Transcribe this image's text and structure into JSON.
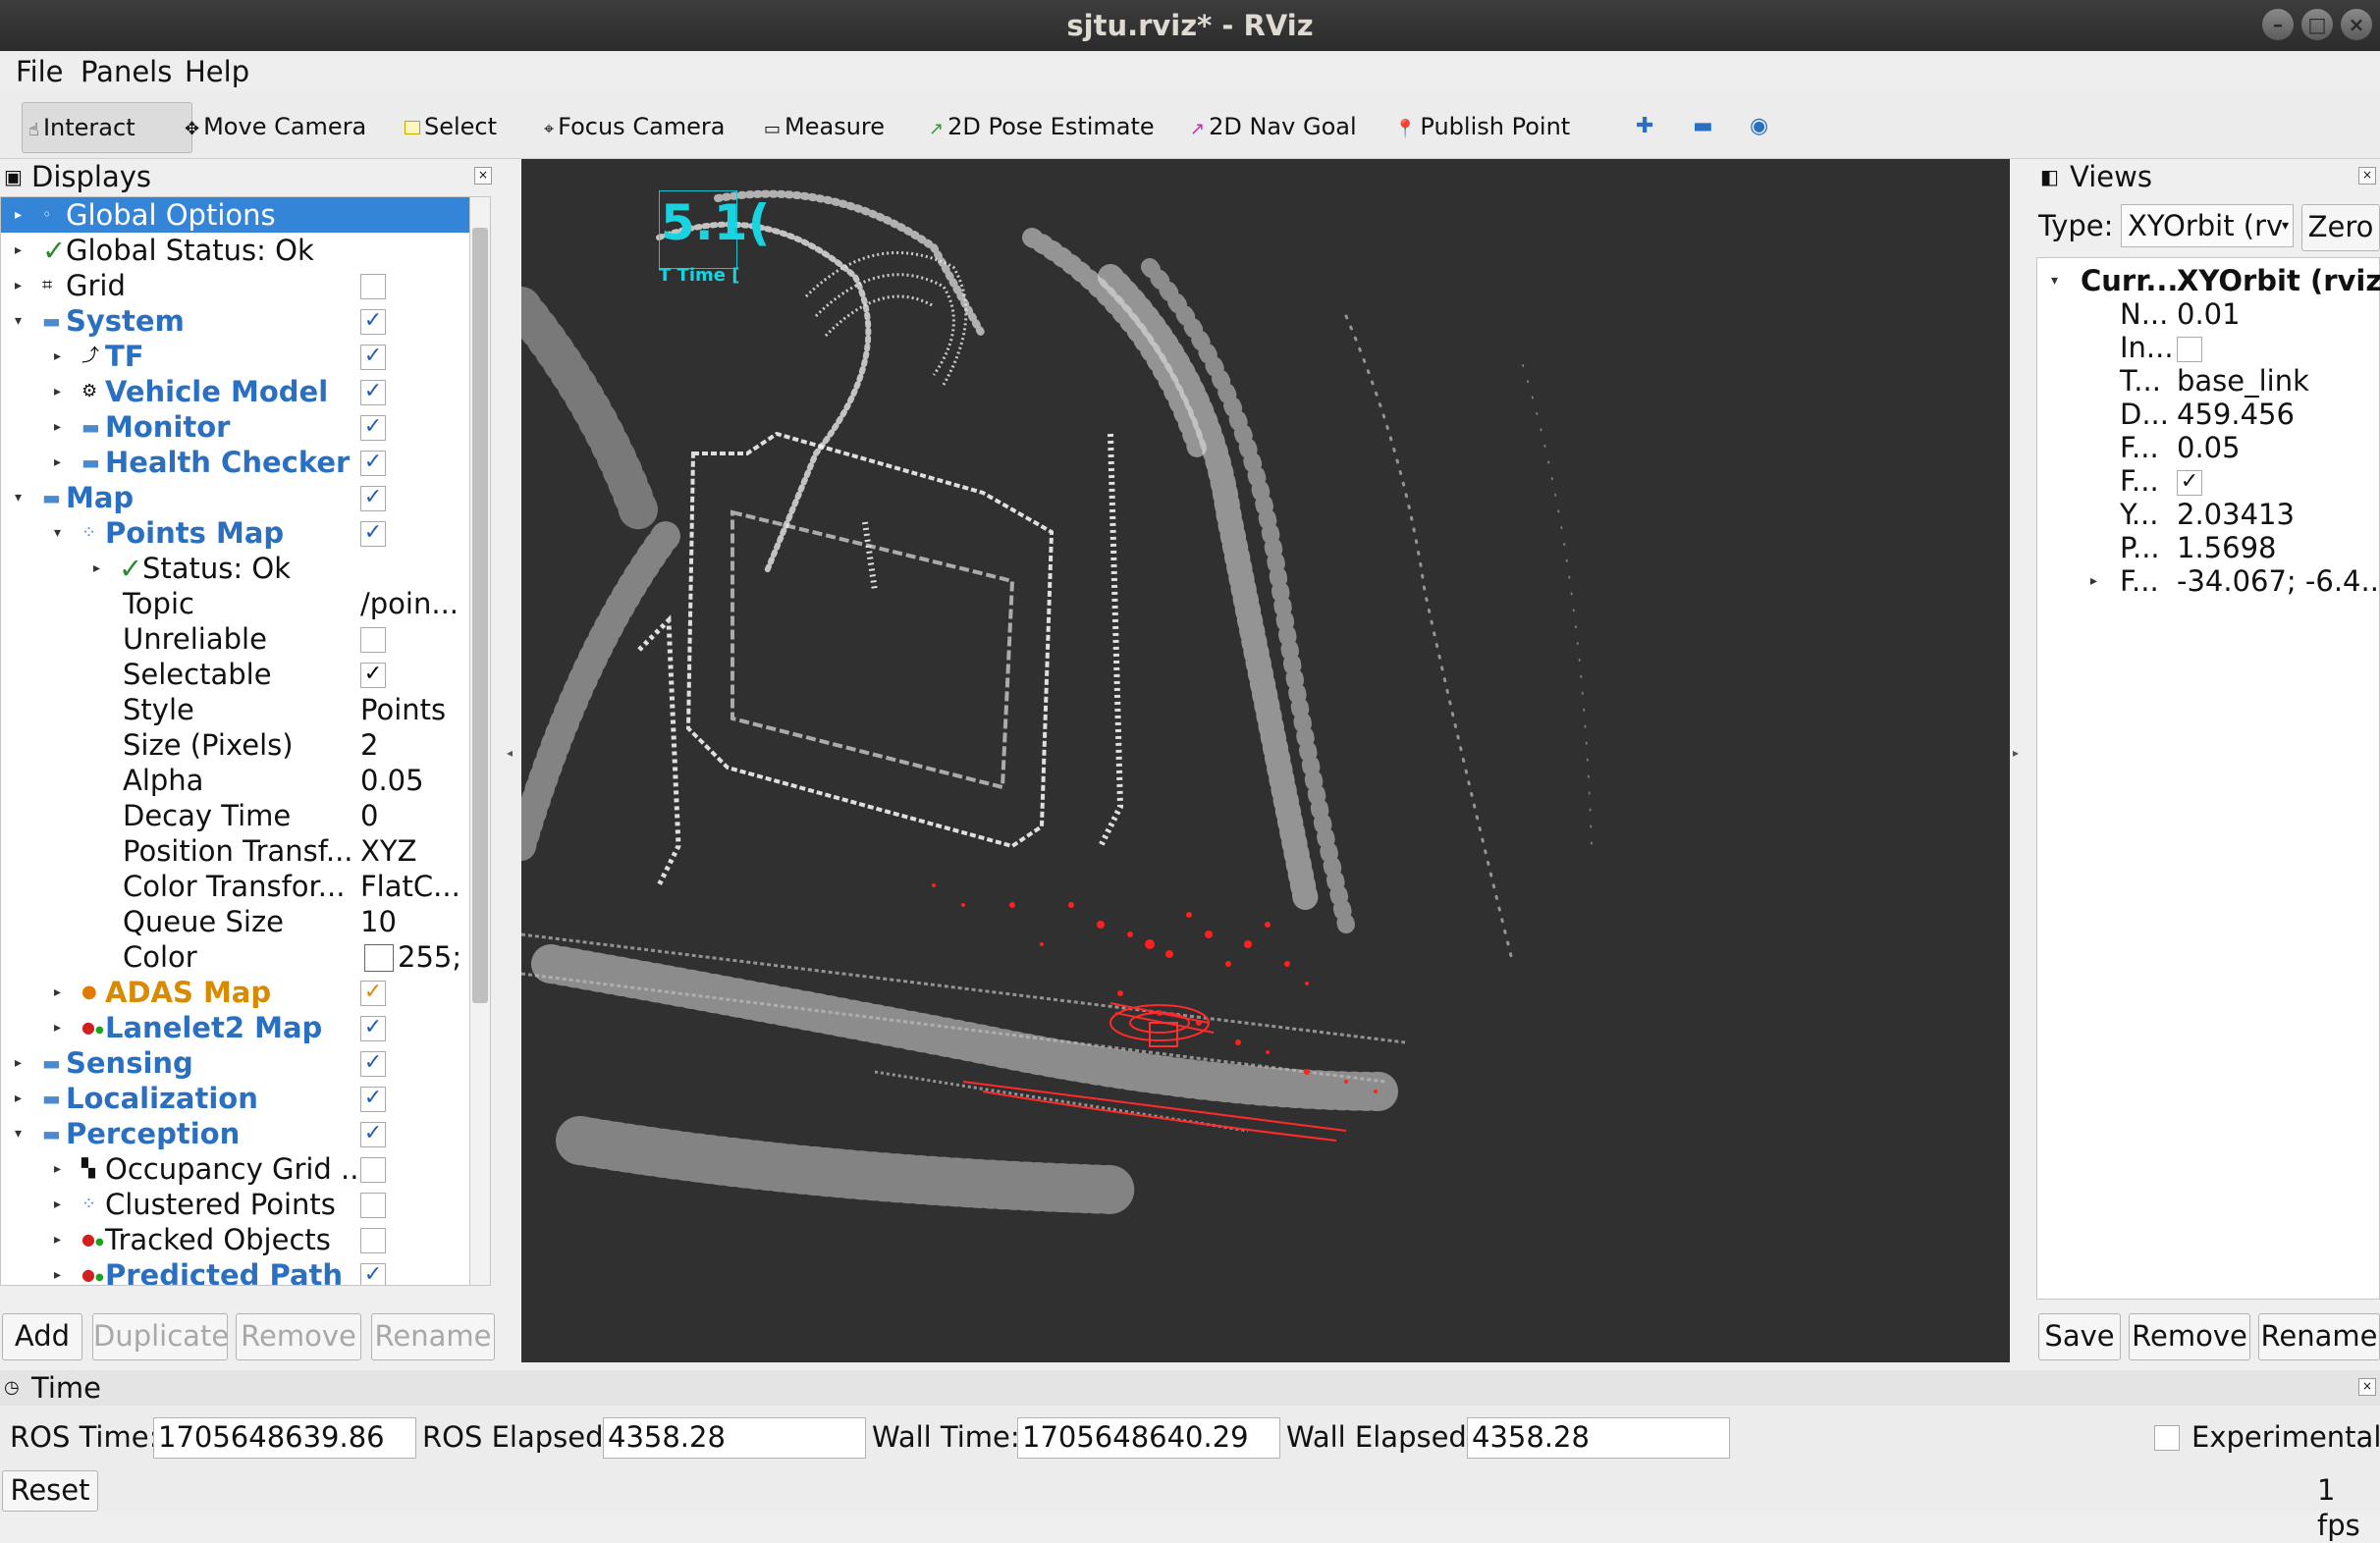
{
  "window": {
    "title": "sjtu.rviz* - RViz"
  },
  "menu": {
    "file": "File",
    "panels": "Panels",
    "help": "Help"
  },
  "toolbar": {
    "interact": "Interact",
    "move_camera": "Move Camera",
    "select": "Select",
    "focus_camera": "Focus Camera",
    "measure": "Measure",
    "pose_estimate": "2D Pose Estimate",
    "nav_goal": "2D Nav Goal",
    "publish_point": "Publish Point"
  },
  "displays": {
    "title": "Displays",
    "items": {
      "global_options": "Global Options",
      "global_status": "Global Status: Ok",
      "grid": "Grid",
      "system": "System",
      "tf": "TF",
      "vehicle_model": "Vehicle Model",
      "monitor": "Monitor",
      "health_checker": "Health Checker",
      "map": "Map",
      "points_map": "Points Map",
      "status_ok": "Status: Ok",
      "topic": "Topic",
      "unreliable": "Unreliable",
      "selectable": "Selectable",
      "style": "Style",
      "size_pixels": "Size (Pixels)",
      "alpha": "Alpha",
      "decay_time": "Decay Time",
      "position_transformer": "Position Transf...",
      "color_transformer": "Color Transfor...",
      "queue_size": "Queue Size",
      "color": "Color",
      "adas_map": "ADAS Map",
      "lanelet2_map": "Lanelet2 Map",
      "sensing": "Sensing",
      "localization": "Localization",
      "perception": "Perception",
      "occupancy_grid": "Occupancy Grid ...",
      "clustered_points": "Clustered Points",
      "tracked_objects": "Tracked Objects",
      "predicted_path": "Predicted Path"
    },
    "values": {
      "topic": "/poin...",
      "style": "Points",
      "size_pixels": "2",
      "alpha": "0.05",
      "decay_time": "0",
      "position_transformer": "XYZ",
      "color_transformer": "FlatC...",
      "queue_size": "10",
      "color": "255;"
    },
    "buttons": {
      "add": "Add",
      "duplicate": "Duplicate",
      "remove": "Remove",
      "rename": "Rename"
    }
  },
  "viewport": {
    "overlay_value": "5.1(",
    "overlay_label": "T Time ["
  },
  "views": {
    "title": "Views",
    "type_label": "Type:",
    "type_value": "XYOrbit (rv",
    "zero": "Zero",
    "current_label": "Curr...",
    "current_value": "XYOrbit (rviz)",
    "props": [
      {
        "name": "N...",
        "value": "0.01"
      },
      {
        "name": "In...",
        "value": ""
      },
      {
        "name": "T...",
        "value": "base_link"
      },
      {
        "name": "D...",
        "value": "459.456"
      },
      {
        "name": "F...",
        "value": "0.05"
      },
      {
        "name": "F...",
        "value": "✓"
      },
      {
        "name": "Y...",
        "value": "2.03413"
      },
      {
        "name": "P...",
        "value": "1.5698"
      },
      {
        "name": "F...",
        "value": "-34.067; -6.4..."
      }
    ],
    "buttons": {
      "save": "Save",
      "remove": "Remove",
      "rename": "Rename"
    }
  },
  "time": {
    "title": "Time",
    "ros_time_label": "ROS Time:",
    "ros_time": "1705648639.86",
    "ros_elapsed_label": "ROS Elapsed:",
    "ros_elapsed": "4358.28",
    "wall_time_label": "Wall Time:",
    "wall_time": "1705648640.29",
    "wall_elapsed_label": "Wall Elapsed:",
    "wall_elapsed": "4358.28",
    "experimental": "Experimental",
    "reset": "Reset",
    "fps": "1 fps"
  },
  "colors": {
    "selection": "#3484d8",
    "accent_blue": "#2a6fc0",
    "accent_orange": "#d88a00",
    "viewport_bg": "#303030",
    "overlay_cyan": "#19d3e0"
  }
}
